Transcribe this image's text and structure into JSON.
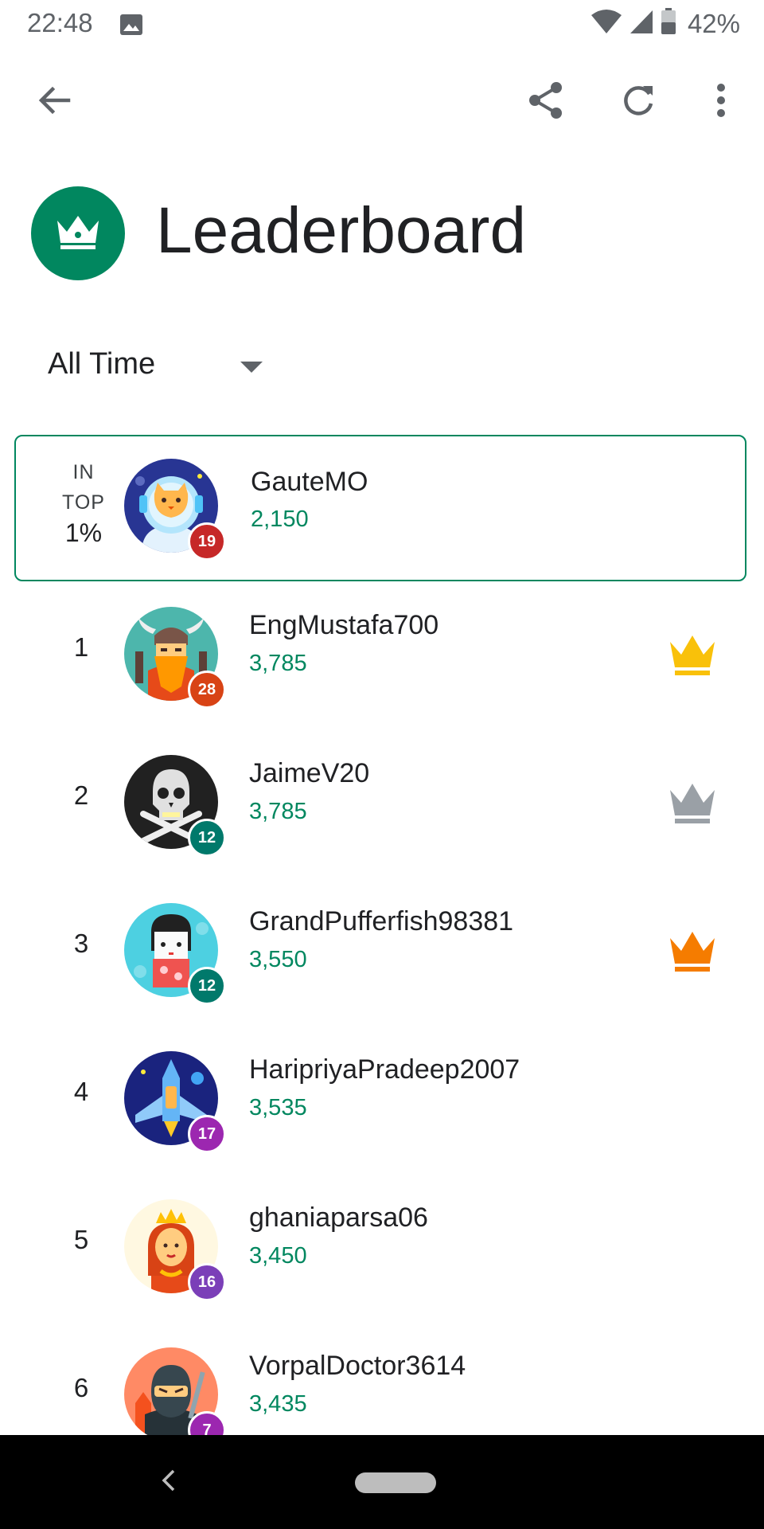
{
  "status_bar": {
    "time": "22:48",
    "battery": "42%"
  },
  "header": {
    "title": "Leaderboard"
  },
  "filter": {
    "selected": "All Time"
  },
  "user_rank": {
    "label_line1": "IN",
    "label_line2": "TOP",
    "percent": "1%",
    "name": "GauteMO",
    "score": "2,150",
    "level": "19",
    "level_color": "#c62828"
  },
  "leaderboard": [
    {
      "rank": "1",
      "name": "EngMustafa700",
      "score": "3,785",
      "level": "28",
      "level_color": "#d84315",
      "crown": "gold-crown-icon"
    },
    {
      "rank": "2",
      "name": "JaimeV20",
      "score": "3,785",
      "level": "12",
      "level_color": "#00796b",
      "crown": "silver-crown-icon"
    },
    {
      "rank": "3",
      "name": "GrandPufferfish98381",
      "score": "3,550",
      "level": "12",
      "level_color": "#00796b",
      "crown": "bronze-crown-icon"
    },
    {
      "rank": "4",
      "name": "HaripriyaPradeep2007",
      "score": "3,535",
      "level": "17",
      "level_color": "#9c27b0"
    },
    {
      "rank": "5",
      "name": "ghaniaparsa06",
      "score": "3,450",
      "level": "16",
      "level_color": "#7b3fb8"
    },
    {
      "rank": "6",
      "name": "VorpalDoctor3614",
      "score": "3,435",
      "level": "7",
      "level_color": "#9c27b0"
    }
  ],
  "colors": {
    "accent": "#01875f",
    "crown_gold": "#f9c10a",
    "crown_silver": "#9aa0a6",
    "crown_bronze": "#f57c00"
  }
}
